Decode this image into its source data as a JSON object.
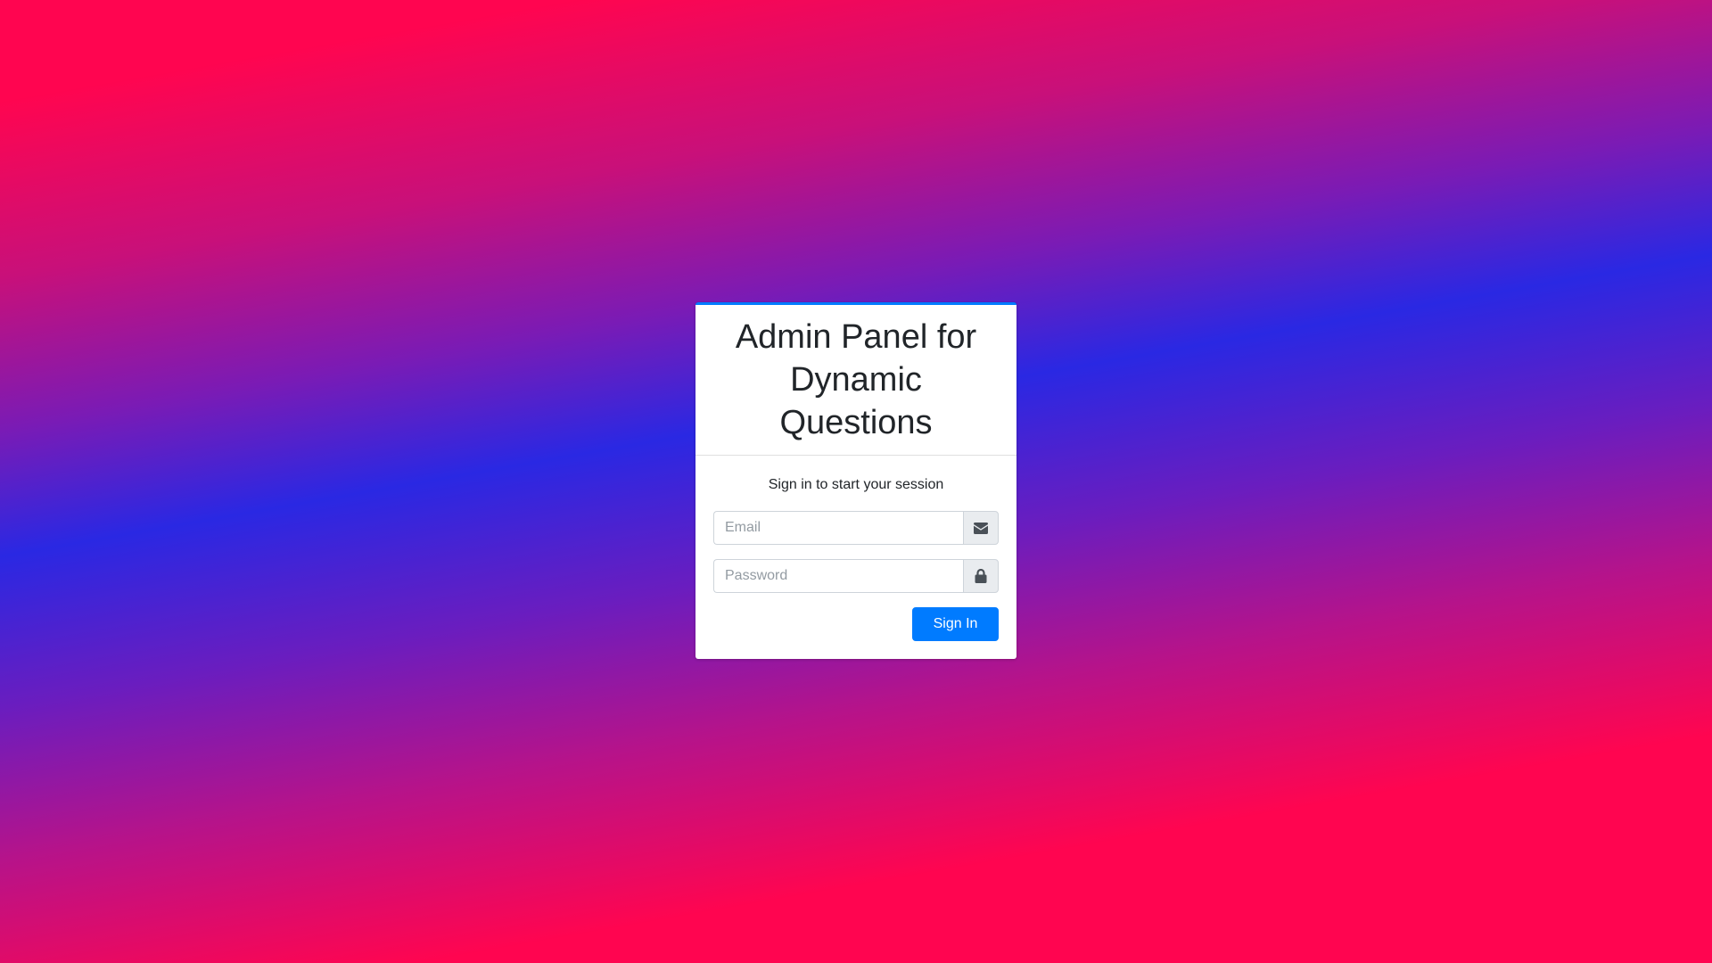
{
  "login": {
    "title": "Admin Panel for Dynamic Questions",
    "message": "Sign in to start your session",
    "email": {
      "placeholder": "Email",
      "value": "",
      "icon": "envelope-icon"
    },
    "password": {
      "placeholder": "Password",
      "value": "",
      "icon": "lock-icon"
    },
    "submit_label": "Sign In"
  },
  "colors": {
    "accent": "#007bff",
    "background_pink": "#ff0550",
    "background_blue": "#2a28e3"
  }
}
